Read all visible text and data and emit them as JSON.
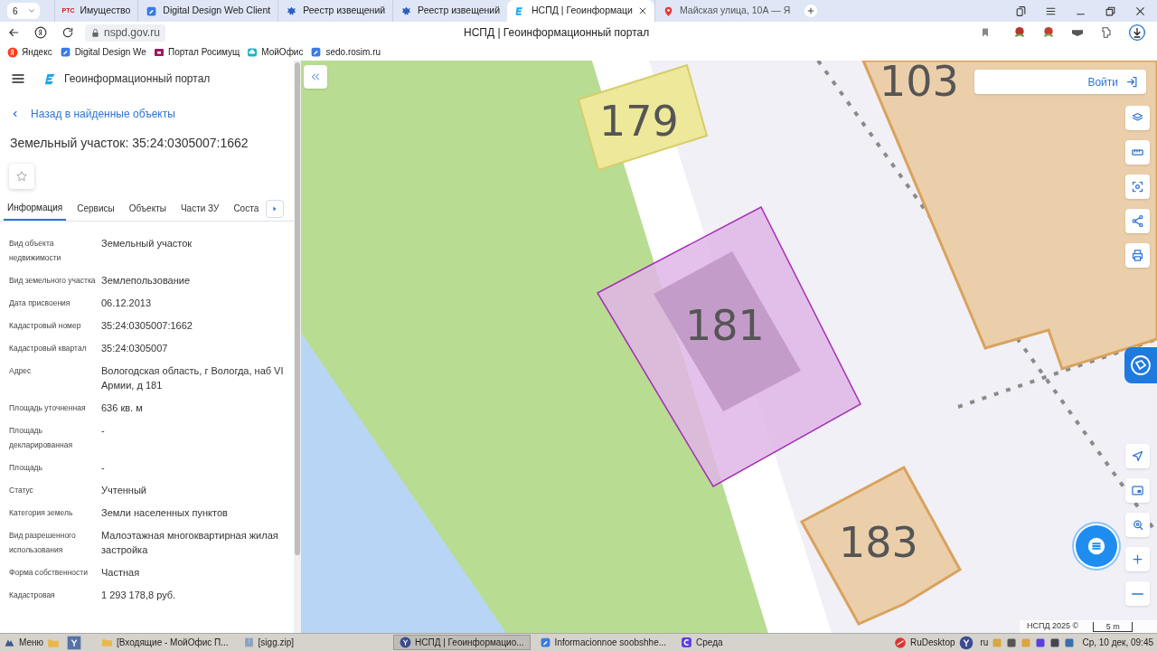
{
  "browser": {
    "tab_count": "6",
    "tabs": [
      {
        "title": "Имущество",
        "icon_text": "РТС",
        "selected": false
      },
      {
        "title": "Digital Design Web Client",
        "selected": false
      },
      {
        "title": "Реестр извещений",
        "selected": false
      },
      {
        "title": "Реестр извещений",
        "selected": false
      },
      {
        "title": "НСПД | Геоинформаци",
        "selected": true
      },
      {
        "title": "Майская улица, 10А — Я",
        "selected": false
      }
    ],
    "address": "nspd.gov.ru",
    "page_title": "НСПД | Геоинформационный портал",
    "bookmarks": [
      {
        "title": "Яндекс"
      },
      {
        "title": "Digital Design We"
      },
      {
        "title": "Портал Росимущ"
      },
      {
        "title": "МойОфис"
      },
      {
        "title": "sedo.rosim.ru"
      }
    ]
  },
  "panel": {
    "app_title": "Геоинформационный портал",
    "back_link": "Назад в найденные объекты",
    "title": "Земельный участок: 35:24:0305007:1662",
    "tabs": [
      {
        "label": "Информация",
        "selected": true
      },
      {
        "label": "Сервисы",
        "selected": false
      },
      {
        "label": "Объекты",
        "selected": false
      },
      {
        "label": "Части ЗУ",
        "selected": false
      },
      {
        "label": "Соста",
        "selected": false
      }
    ],
    "fields": [
      {
        "label": "Вид объекта недвижимости",
        "value": "Земельный участок"
      },
      {
        "label": "Вид земельного участка",
        "value": "Землепользование"
      },
      {
        "label": "Дата присвоения",
        "value": "06.12.2013"
      },
      {
        "label": "Кадастровый номер",
        "value": "35:24:0305007:1662"
      },
      {
        "label": "Кадастровый квартал",
        "value": "35:24:0305007"
      },
      {
        "label": "Адрес",
        "value": "Вологодская область, г Вологда, наб VI Армии, д 181"
      },
      {
        "label": "Площадь уточненная",
        "value": "636 кв. м"
      },
      {
        "label": "Площадь декларированная",
        "value": "-"
      },
      {
        "label": "Площадь",
        "value": "-"
      },
      {
        "label": "Статус",
        "value": "Учтенный"
      },
      {
        "label": "Категория земель",
        "value": "Земли населенных пунктов"
      },
      {
        "label": "Вид разрешенного использования",
        "value": "Малоэтажная многоквартирная жилая застройка"
      },
      {
        "label": "Форма собственности",
        "value": "Частная"
      },
      {
        "label": "Кадастровая",
        "value": "1 293 178,8 руб."
      }
    ]
  },
  "map": {
    "login": "Войти",
    "labels": [
      "103",
      "179",
      "181",
      "183"
    ],
    "attribution": "НСПД 2025 ©",
    "scale": "5 m"
  },
  "taskbar": {
    "menu": "Меню",
    "windows": [
      {
        "title": "[Входящие - МойОфис П...",
        "selected": false
      },
      {
        "title": "[sigg.zip]",
        "selected": false
      },
      {
        "title": "НСПД | Геоинформацио...",
        "selected": true
      },
      {
        "title": "Informacionnoe soobshhe...",
        "selected": false
      },
      {
        "title": "Среда",
        "selected": false
      }
    ],
    "tray_app": "RuDesktop",
    "lang": "ru",
    "clock": "Ср, 10 дек, 09:45"
  }
}
